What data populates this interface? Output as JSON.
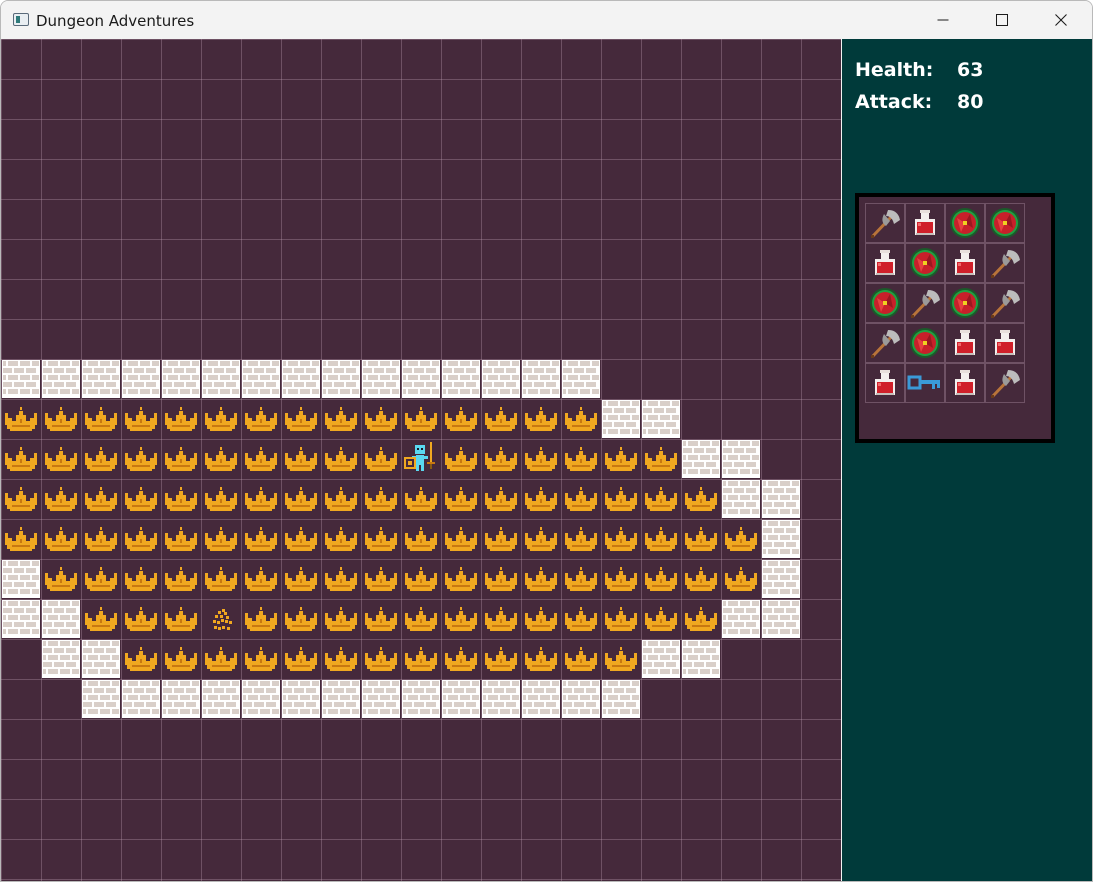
{
  "window": {
    "title": "Dungeon Adventures",
    "controls": [
      "minimize",
      "maximize",
      "close"
    ]
  },
  "stats": [
    {
      "label": "Health:",
      "value": "63"
    },
    {
      "label": "Attack:",
      "value": "80"
    }
  ],
  "colors": {
    "floor": "#45293b",
    "sidebar": "#003a3a",
    "wall": "#d9cfc9",
    "coin": "#f0a820",
    "hero": "#5ad8f0"
  },
  "map": {
    "legend": {
      "W": "brick-wall",
      "C": "gold-crown",
      "T": "empty-crown",
      "P": "hero",
      ".": "floor"
    },
    "rows": [
      ".....................",
      ".....................",
      ".....................",
      ".....................",
      ".....................",
      ".....................",
      ".....................",
      ".....................",
      "WWWWWWWWWWWWWWW......",
      "CCCCCCCCCCCCCCCWW....",
      "CCCCCCCCCCPCCCCCCWW..",
      "CCCCCCCCCCCCCCCCCCWW.",
      "CCCCCCCCCCCCCCCCCCCW.",
      "WCCCCCCCCCCCCCCCCCCW.",
      "WWCCCTCCCCCCCCCCCCWW.",
      ".WWCCCCCCCCCCCCCWW...",
      "..WWWWWWWWWWWWWW.....",
      ".....................",
      ".....................",
      ".....................",
      "....................."
    ]
  },
  "inventory": {
    "rows": [
      [
        "axe",
        "potion",
        "shield",
        "shield"
      ],
      [
        "potion",
        "shield",
        "potion",
        "axe"
      ],
      [
        "shield",
        "axe",
        "shield",
        "axe"
      ],
      [
        "axe",
        "shield",
        "potion",
        "potion"
      ],
      [
        "potion",
        "key",
        "potion",
        "axe"
      ]
    ]
  }
}
